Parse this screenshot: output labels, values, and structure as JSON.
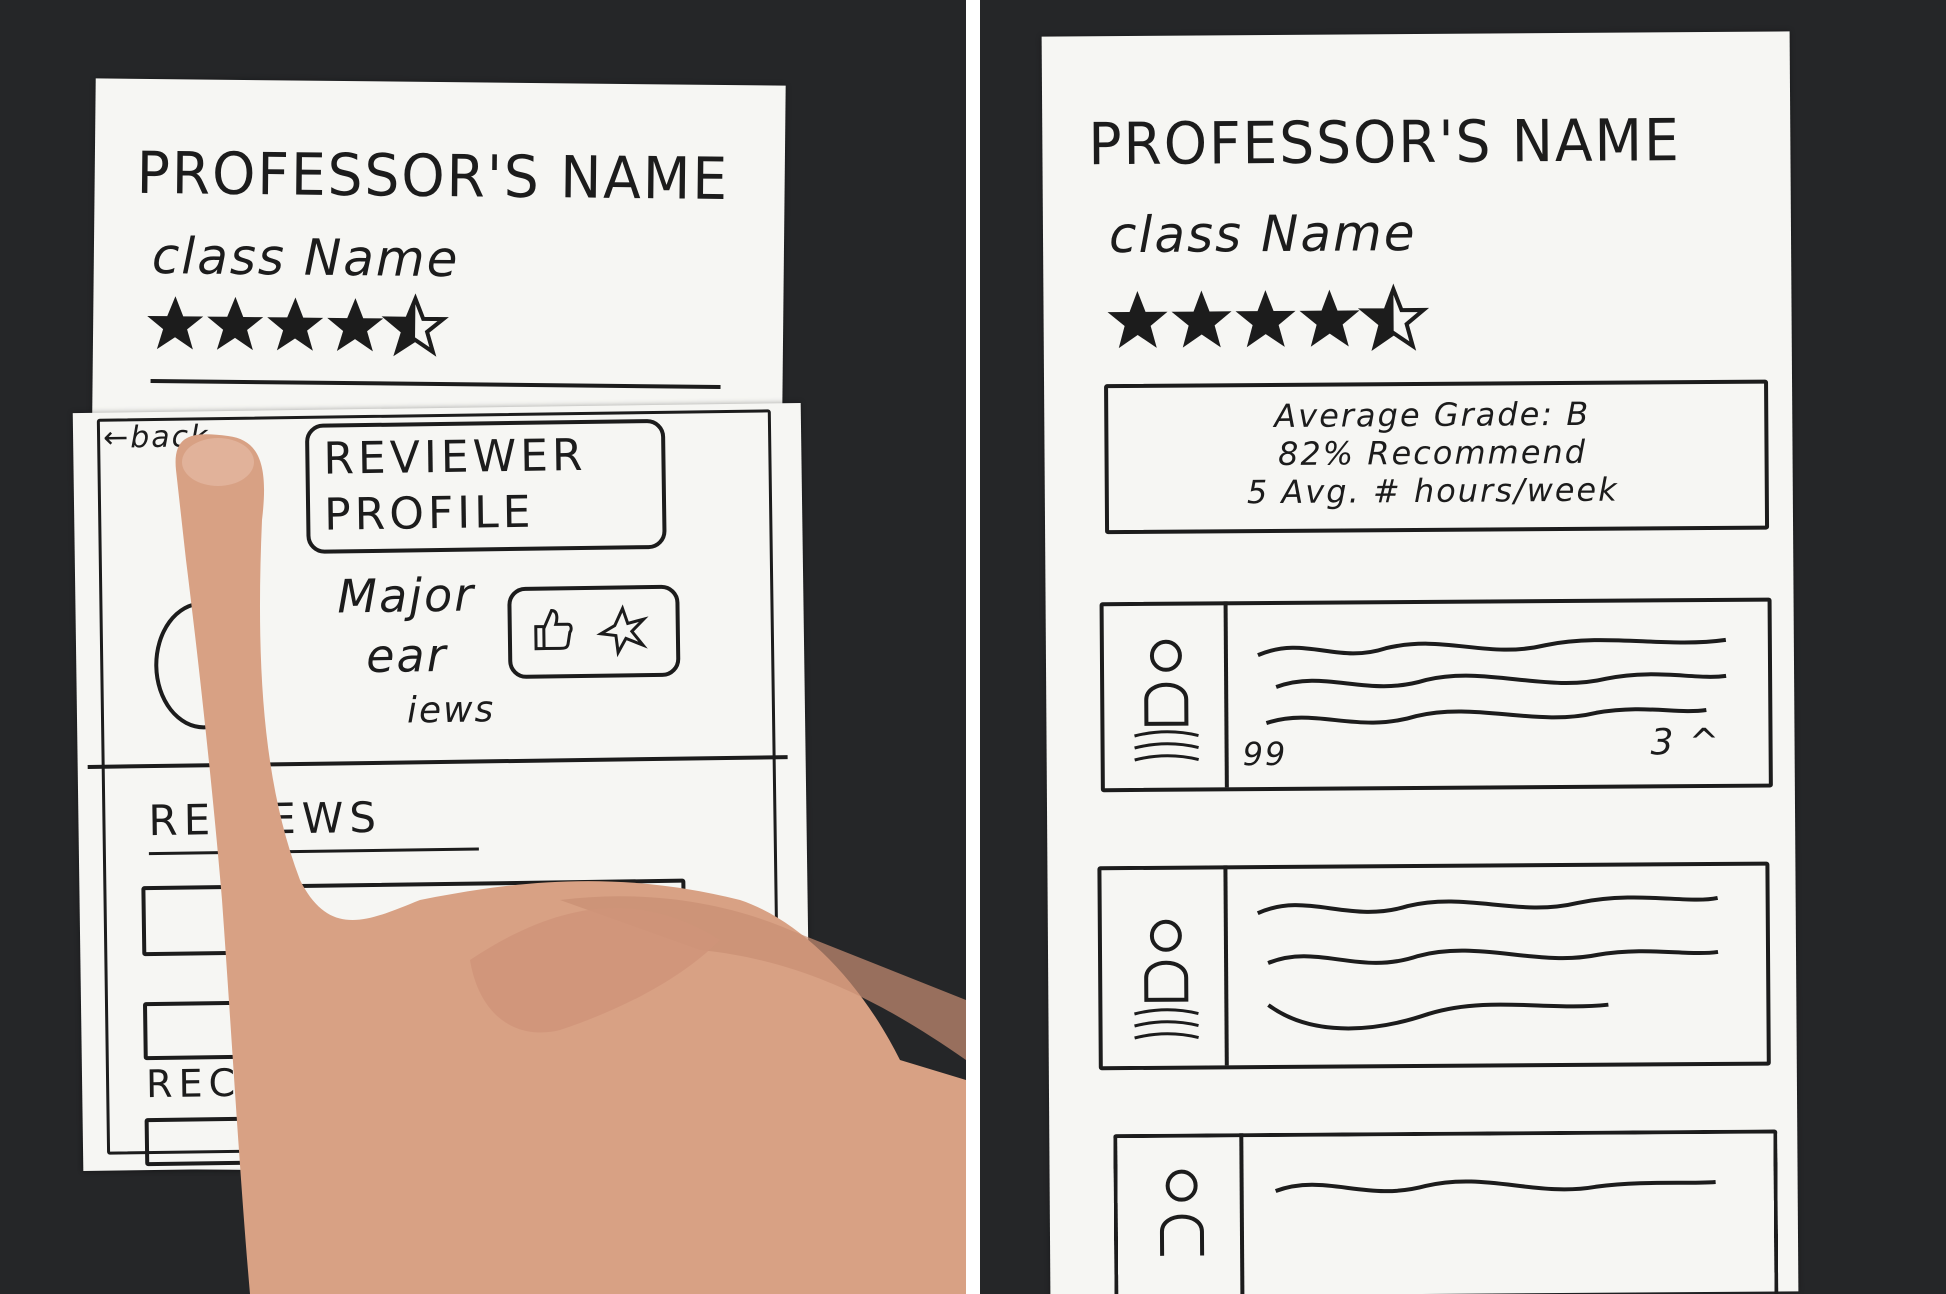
{
  "left_sketch": {
    "page_title": "PROFESSOR'S NAME",
    "class_name": "class Name",
    "rating_icons": "star-rating-icons",
    "overlay": {
      "back_link": "←back",
      "header": "REVIEWER PROFILE",
      "info_lines": [
        "Major",
        "ear",
        "iews"
      ],
      "tab_label": "REVIEWS",
      "section_label": "REC"
    }
  },
  "right_sketch": {
    "page_title": "PROFESSOR'S NAME",
    "class_name": "class Name",
    "stats": {
      "line1": "Average Grade: B",
      "line2": "82% Recommend",
      "line3": "5 Avg. # hours/week"
    },
    "review_card_1": {
      "left_count": "99",
      "right_count": "3 ^"
    }
  },
  "colors": {
    "background": "#252628",
    "paper": "#f6f6f3",
    "ink": "#1c1c1c",
    "skin": "#d8a184"
  }
}
